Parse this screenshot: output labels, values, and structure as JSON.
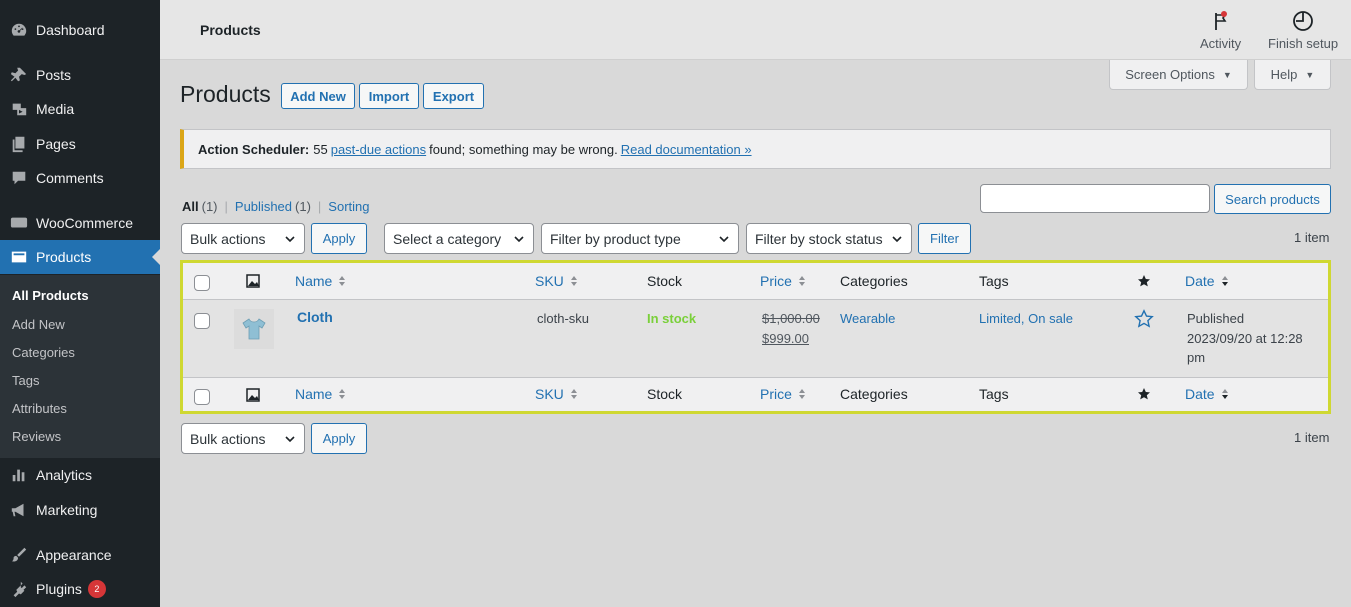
{
  "sidebar": {
    "items": [
      {
        "label": "Dashboard",
        "icon": "dashboard-icon"
      },
      {
        "label": "Posts",
        "icon": "pin-icon"
      },
      {
        "label": "Media",
        "icon": "media-icon"
      },
      {
        "label": "Pages",
        "icon": "pages-icon"
      },
      {
        "label": "Comments",
        "icon": "comments-icon"
      },
      {
        "label": "WooCommerce",
        "icon": "woocommerce-icon"
      },
      {
        "label": "Products",
        "icon": "products-icon"
      },
      {
        "label": "Analytics",
        "icon": "analytics-icon"
      },
      {
        "label": "Marketing",
        "icon": "megaphone-icon"
      },
      {
        "label": "Appearance",
        "icon": "brush-icon"
      },
      {
        "label": "Plugins",
        "icon": "plugin-icon",
        "badge": "2"
      }
    ],
    "submenu": [
      "All Products",
      "Add New",
      "Categories",
      "Tags",
      "Attributes",
      "Reviews"
    ]
  },
  "header": {
    "title": "Products",
    "activity_label": "Activity",
    "finish_setup_label": "Finish setup"
  },
  "screen_options": {
    "label": "Screen Options"
  },
  "help": {
    "label": "Help"
  },
  "page": {
    "heading": "Products",
    "add_new": "Add New",
    "import": "Import",
    "export": "Export"
  },
  "notice": {
    "prefix": "Action Scheduler:",
    "count": "55",
    "link_text": "past-due actions",
    "middle": "found; something may be wrong.",
    "doc_link": "Read documentation »"
  },
  "views": {
    "all": "All",
    "all_count": "(1)",
    "published": "Published",
    "published_count": "(1)",
    "sorting": "Sorting"
  },
  "search": {
    "button": "Search products",
    "value": ""
  },
  "filters": {
    "bulk_actions": "Bulk actions",
    "apply": "Apply",
    "category": "Select a category",
    "product_type": "Filter by product type",
    "stock_status": "Filter by stock status",
    "filter": "Filter",
    "items_count": "1 item"
  },
  "table": {
    "columns": {
      "name": "Name",
      "sku": "SKU",
      "stock": "Stock",
      "price": "Price",
      "categories": "Categories",
      "tags": "Tags",
      "date": "Date"
    },
    "rows": [
      {
        "name": "Cloth",
        "sku": "cloth-sku",
        "stock": "In stock",
        "regular_price": "$1,000.00",
        "sale_price": "$999.00",
        "categories": "Wearable",
        "tags": "Limited, On sale",
        "status": "Published",
        "date": "2023/09/20 at 12:28",
        "time_suffix": "pm"
      }
    ]
  },
  "bottom": {
    "bulk_actions": "Bulk actions",
    "apply": "Apply",
    "items_count": "1 item"
  },
  "colors": {
    "accent": "#2271b1",
    "sidebar": "#1d2327",
    "in_stock": "#7ad03a",
    "highlight": "#cfd832",
    "badge": "#d63638"
  }
}
